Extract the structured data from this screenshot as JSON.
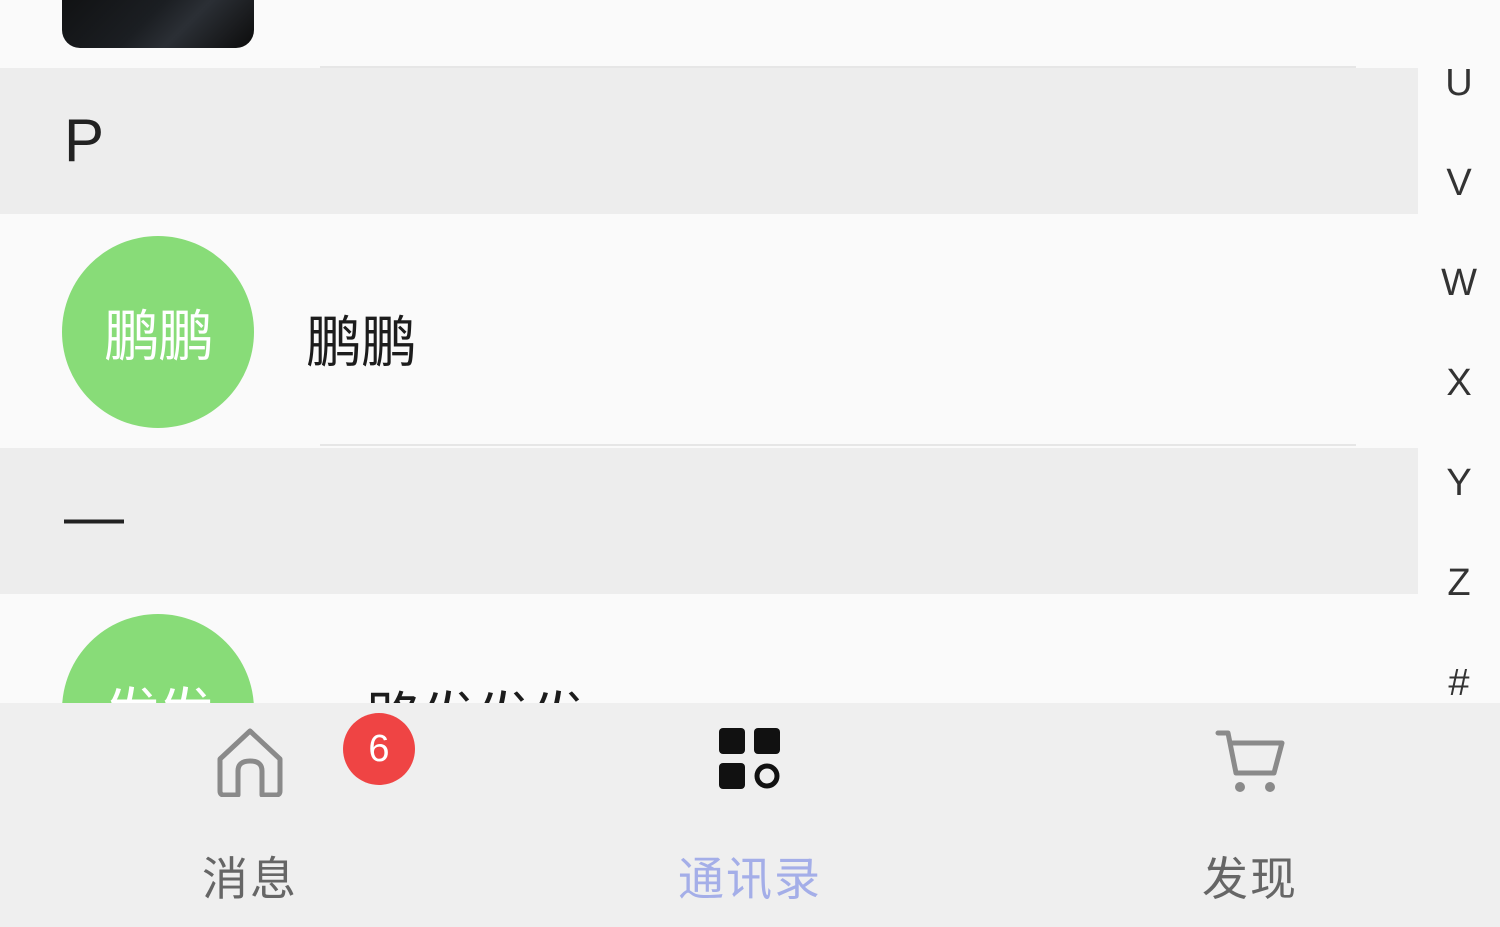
{
  "contacts_top": {
    "name": ""
  },
  "sections": [
    {
      "letter": "P",
      "contacts": [
        {
          "avatar_text": "鹏鹏",
          "name": "鹏鹏"
        }
      ]
    },
    {
      "letter": "—",
      "contacts": [
        {
          "avatar_text": "发发",
          "name": "路发发发"
        }
      ]
    }
  ],
  "alpha_index": [
    "U",
    "V",
    "W",
    "X",
    "Y",
    "Z",
    "#"
  ],
  "tabbar": {
    "tabs": [
      {
        "label": "消息",
        "icon": "home-icon",
        "badge": "6",
        "active": false
      },
      {
        "label": "通讯录",
        "icon": "grid-icon",
        "active": true
      },
      {
        "label": "发现",
        "icon": "cart-icon",
        "active": false
      }
    ]
  },
  "colors": {
    "avatar_green": "#88dc78",
    "active_tab": "#a4aee8",
    "badge_red": "#ef4444",
    "section_bg": "#ededed"
  }
}
